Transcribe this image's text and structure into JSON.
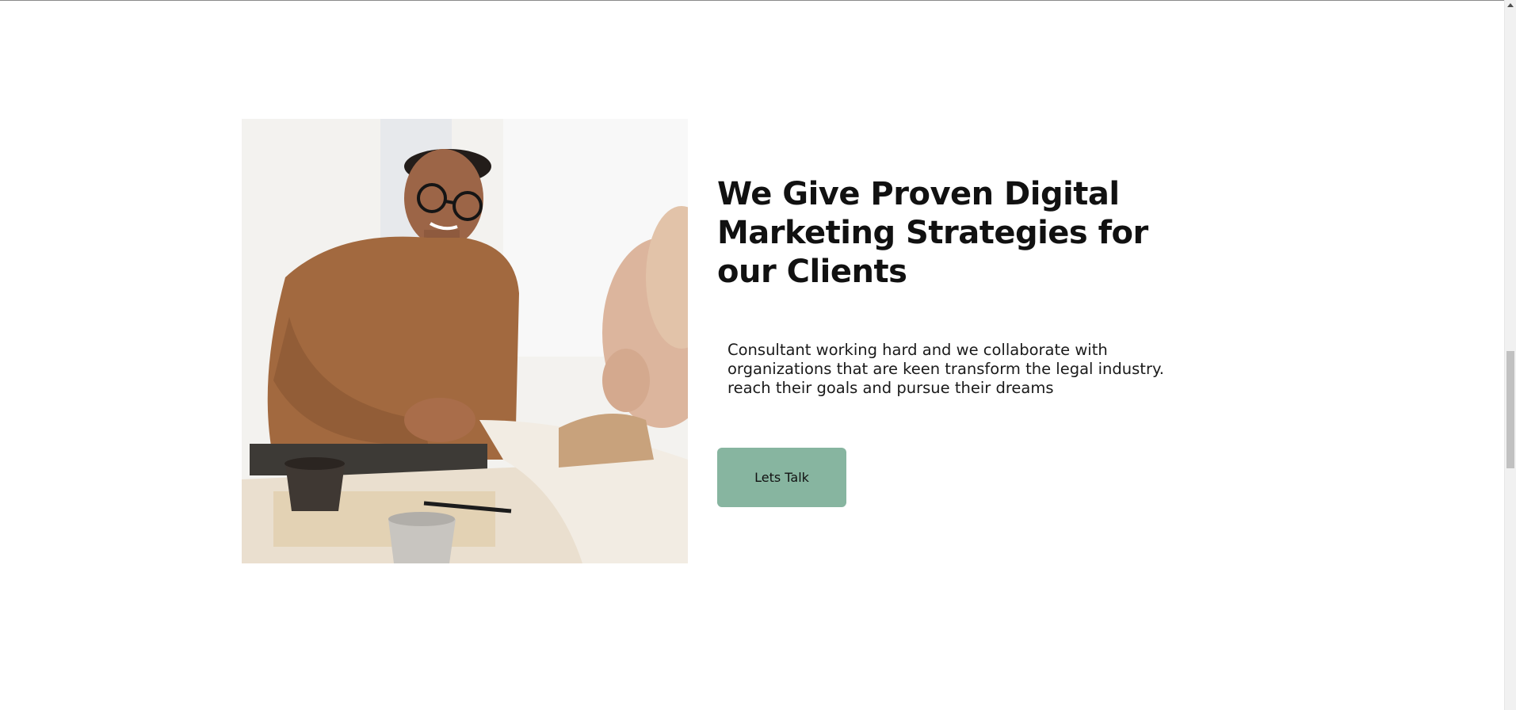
{
  "hero": {
    "title": "We Give Proven Digital Marketing Strategies for our Clients",
    "description": "Consultant working hard and we collaborate with\norganizations that are keen transform the legal industry.\nreach their goals and pursue their dreams",
    "cta_label": "Lets Talk",
    "image_alt": "Two people shaking hands across a meeting table"
  },
  "colors": {
    "cta_background": "#87b5a0",
    "text": "#111111",
    "background": "#ffffff"
  },
  "scrollbar": {
    "up_icon": "scroll-up-arrow-icon"
  }
}
